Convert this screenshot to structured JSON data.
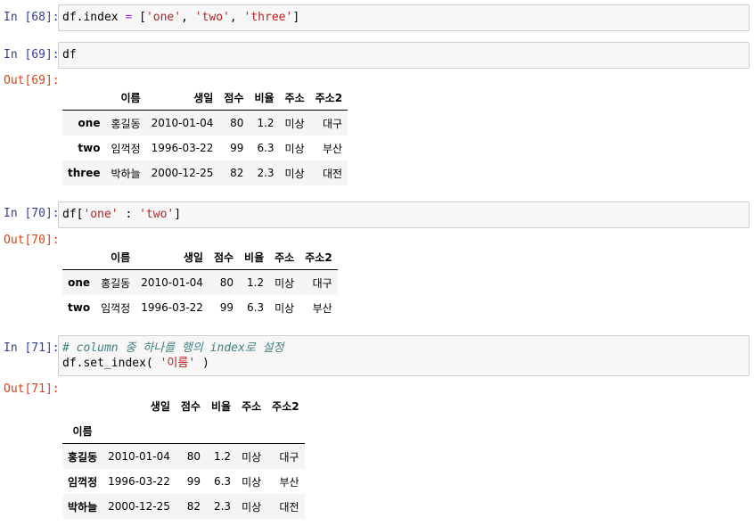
{
  "cells": [
    {
      "in_prompt": "In [68]:",
      "code": "df.index = ['one', 'two', 'three']"
    },
    {
      "in_prompt": "In [69]:",
      "code": "df",
      "out_prompt": "Out[69]:"
    },
    {
      "in_prompt": "In [70]:",
      "code": "df['one' : 'two']",
      "out_prompt": "Out[70]:"
    },
    {
      "in_prompt": "In [71]:",
      "comment": "# column 중 하나를 행의 index로 설정",
      "code": "df.set_index( '이름' )",
      "out_prompt": "Out[71]:"
    }
  ],
  "code_parts": {
    "c68": {
      "a": "df.index ",
      "eq": "=",
      "b": " [",
      "s1": "'one'",
      "c1": ", ",
      "s2": "'two'",
      "c2": ", ",
      "s3": "'three'",
      "e": "]"
    },
    "c70": {
      "a": "df[",
      "s1": "'one'",
      "b": " : ",
      "s2": "'two'",
      "e": "]"
    },
    "c71": {
      "a": "df.set_index( ",
      "s1": "'이름'",
      "e": " )"
    }
  },
  "table69": {
    "columns": [
      "이름",
      "생일",
      "점수",
      "비율",
      "주소",
      "주소2"
    ],
    "rows": [
      {
        "index": "one",
        "values": [
          "홍길동",
          "2010-01-04",
          "80",
          "1.2",
          "미상",
          "대구"
        ]
      },
      {
        "index": "two",
        "values": [
          "임꺽정",
          "1996-03-22",
          "99",
          "6.3",
          "미상",
          "부산"
        ]
      },
      {
        "index": "three",
        "values": [
          "박하늘",
          "2000-12-25",
          "82",
          "2.3",
          "미상",
          "대전"
        ]
      }
    ]
  },
  "table70": {
    "columns": [
      "이름",
      "생일",
      "점수",
      "비율",
      "주소",
      "주소2"
    ],
    "rows": [
      {
        "index": "one",
        "values": [
          "홍길동",
          "2010-01-04",
          "80",
          "1.2",
          "미상",
          "대구"
        ]
      },
      {
        "index": "two",
        "values": [
          "임꺽정",
          "1996-03-22",
          "99",
          "6.3",
          "미상",
          "부산"
        ]
      }
    ]
  },
  "table71": {
    "columns": [
      "생일",
      "점수",
      "비율",
      "주소",
      "주소2"
    ],
    "index_name": "이름",
    "rows": [
      {
        "index": "홍길동",
        "values": [
          "2010-01-04",
          "80",
          "1.2",
          "미상",
          "대구"
        ]
      },
      {
        "index": "임꺽정",
        "values": [
          "1996-03-22",
          "99",
          "6.3",
          "미상",
          "부산"
        ]
      },
      {
        "index": "박하늘",
        "values": [
          "2000-12-25",
          "82",
          "2.3",
          "미상",
          "대전"
        ]
      }
    ]
  }
}
